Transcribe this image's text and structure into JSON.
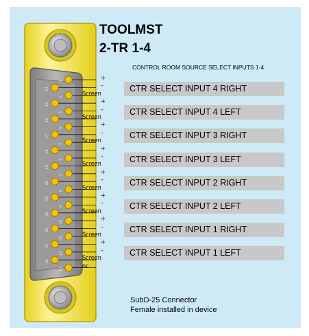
{
  "device": {
    "title": "TOOLMST",
    "subtitle": "2-TR 1-4"
  },
  "header": "CONTROL ROOM SOURCE SELECT INPUTS 1-4",
  "connector": {
    "line1": "SubD-25 Connector",
    "line2": "Female installed in device"
  },
  "pin_numbers": {
    "top_row": [
      "1",
      "2",
      "3",
      "4",
      "5",
      "6",
      "7",
      "8",
      "9",
      "10",
      "11",
      "12",
      "13"
    ],
    "bottom_row": [
      "14",
      "15",
      "16",
      "17",
      "18",
      "19",
      "20",
      "21",
      "22",
      "23",
      "24",
      "25"
    ]
  },
  "signals": [
    "+",
    "–",
    "Screen",
    "+",
    "–",
    "Screen",
    "+",
    "–",
    "Screen",
    "+",
    "–",
    "Screen",
    "+",
    "–",
    "Screen",
    "+",
    "–",
    "Screen",
    "+",
    "–",
    "Screen",
    "+",
    "–",
    "Screen",
    "nc"
  ],
  "channels": [
    "CTR SELECT INPUT 4 RIGHT",
    "CTR SELECT INPUT 4 LEFT",
    "CTR SELECT INPUT 3 RIGHT",
    "CTR SELECT INPUT 3 LEFT",
    "CTR SELECT INPUT 2 RIGHT",
    "CTR SELECT INPUT 2 LEFT",
    "CTR SELECT INPUT 1 RIGHT",
    "CTR SELECT INPUT 1 LEFT"
  ],
  "colors": {
    "background": "#cdeaf6",
    "connector_body": "#f2e33c",
    "pin": "#f5c400",
    "label_bar": "#c8c8c8"
  }
}
